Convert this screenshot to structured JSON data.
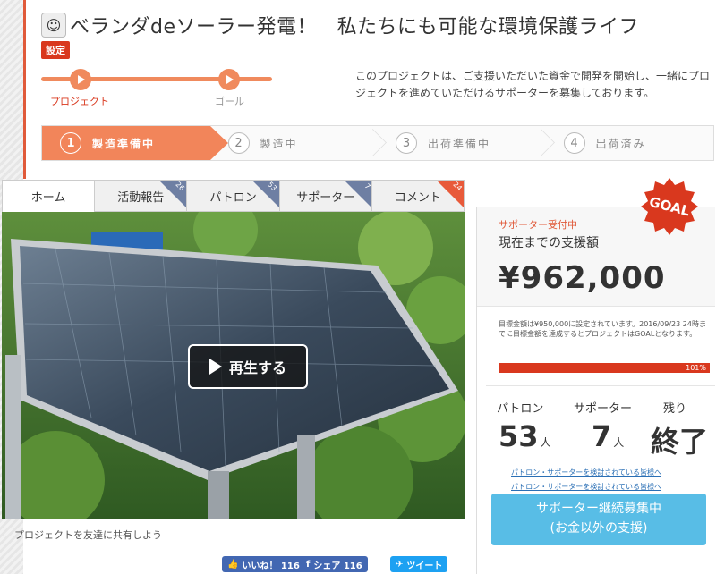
{
  "header": {
    "title": "ベランダdeソーラー発電！　私たちにも可能な環境保護ライフ",
    "settings_label": "設定",
    "mini_progress": {
      "start_label": "プロジェクト",
      "end_label": "ゴール"
    },
    "description": "このプロジェクトは、ご支援いただいた資金で開発を開始し、一緒にプロジェクトを進めていただけるサポーターを募集しております。"
  },
  "steps": [
    {
      "num": "1",
      "label": "製造準備中",
      "active": true
    },
    {
      "num": "2",
      "label": "製造中",
      "active": false
    },
    {
      "num": "3",
      "label": "出荷準備中",
      "active": false
    },
    {
      "num": "4",
      "label": "出荷済み",
      "active": false
    }
  ],
  "tabs": [
    {
      "label": "ホーム",
      "count": ""
    },
    {
      "label": "活動報告",
      "count": "26"
    },
    {
      "label": "パトロン",
      "count": "53"
    },
    {
      "label": "サポーター",
      "count": "7"
    },
    {
      "label": "コメント",
      "count": "24"
    }
  ],
  "video": {
    "play_label": "再生する"
  },
  "share": {
    "text": "プロジェクトを友達に共有しよう",
    "like_label": "いいね！ 116",
    "share_label": "シェア 116",
    "tweet_label": "ツイート"
  },
  "funding": {
    "goal_badge": "GOAL",
    "status": "サポーター受付中",
    "amount_label": "現在までの支援額",
    "amount": "¥962,000",
    "goal_note": "目標金額は¥950,000に設定されています。2016/09/23 24時までに目標金額を達成するとプロジェクトはGOALとなります。",
    "progress_ratio": 1.01,
    "progress_label": "101%"
  },
  "stats": {
    "patron_label": "パトロン",
    "patron_value": "53",
    "patron_unit": "人",
    "supporter_label": "サポーター",
    "supporter_value": "7",
    "supporter_unit": "人",
    "remaining_label": "残り",
    "remaining_value": "終了"
  },
  "links": {
    "link1": "パトロン・サポーターを検討されている皆様へ",
    "link2": "パトロン・サポーターを検討されている皆様へ"
  },
  "cta": {
    "line1": "サポーター継続募集中",
    "line2": "(お金以外の支援)"
  },
  "colors": {
    "accent": "#d9381e",
    "step_active": "#f2855a",
    "cta": "#58bde6",
    "tab_corner": "#6e7fa3"
  }
}
